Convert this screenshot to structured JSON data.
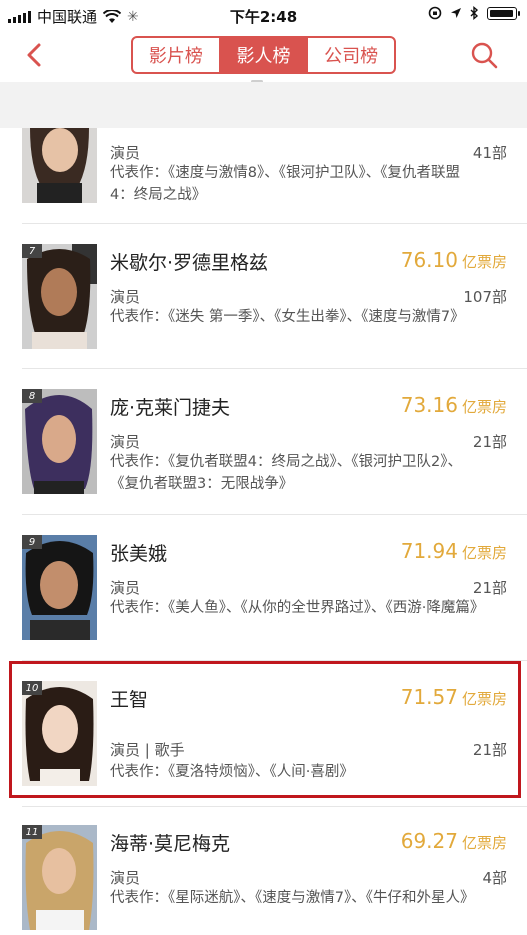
{
  "status_bar": {
    "carrier": "中国联通",
    "time": "下午2:48"
  },
  "nav": {
    "tabs": [
      "影片榜",
      "影人榜",
      "公司榜"
    ],
    "active_tab": 1
  },
  "colors": {
    "accent_red": "#d9534f",
    "highlight_red": "#c0171d",
    "box_office_gold": "#e2a93b"
  },
  "items": [
    {
      "rank": "",
      "name": "",
      "box_value": "",
      "box_unit": "",
      "role": "演员",
      "count": "41部",
      "works": "代表作：《速度与激情8》、《银河护卫队》、《复仇者联盟4：终局之战》"
    },
    {
      "rank": "7",
      "name": "米歇尔·罗德里格兹",
      "box_value": "76.10",
      "box_unit": "亿票房",
      "role": "演员",
      "count": "107部",
      "works": "代表作：《迷失 第一季》、《女生出拳》、《速度与激情7》"
    },
    {
      "rank": "8",
      "name": "庞·克莱门捷夫",
      "box_value": "73.16",
      "box_unit": "亿票房",
      "role": "演员",
      "count": "21部",
      "works": "代表作：《复仇者联盟4：终局之战》、《银河护卫队2》、《复仇者联盟3：无限战争》"
    },
    {
      "rank": "9",
      "name": "张美娥",
      "box_value": "71.94",
      "box_unit": "亿票房",
      "role": "演员",
      "count": "21部",
      "works": "代表作：《美人鱼》、《从你的全世界路过》、《西游·降魔篇》"
    },
    {
      "rank": "10",
      "name": "王智",
      "box_value": "71.57",
      "box_unit": "亿票房",
      "role": "演员 | 歌手",
      "count": "21部",
      "works": "代表作：《夏洛特烦恼》、《人间·喜剧》"
    },
    {
      "rank": "11",
      "name": "海蒂·莫尼梅克",
      "box_value": "69.27",
      "box_unit": "亿票房",
      "role": "演员",
      "count": "4部",
      "works": "代表作：《星际迷航》、《速度与激情7》、《牛仔和外星人》"
    }
  ]
}
